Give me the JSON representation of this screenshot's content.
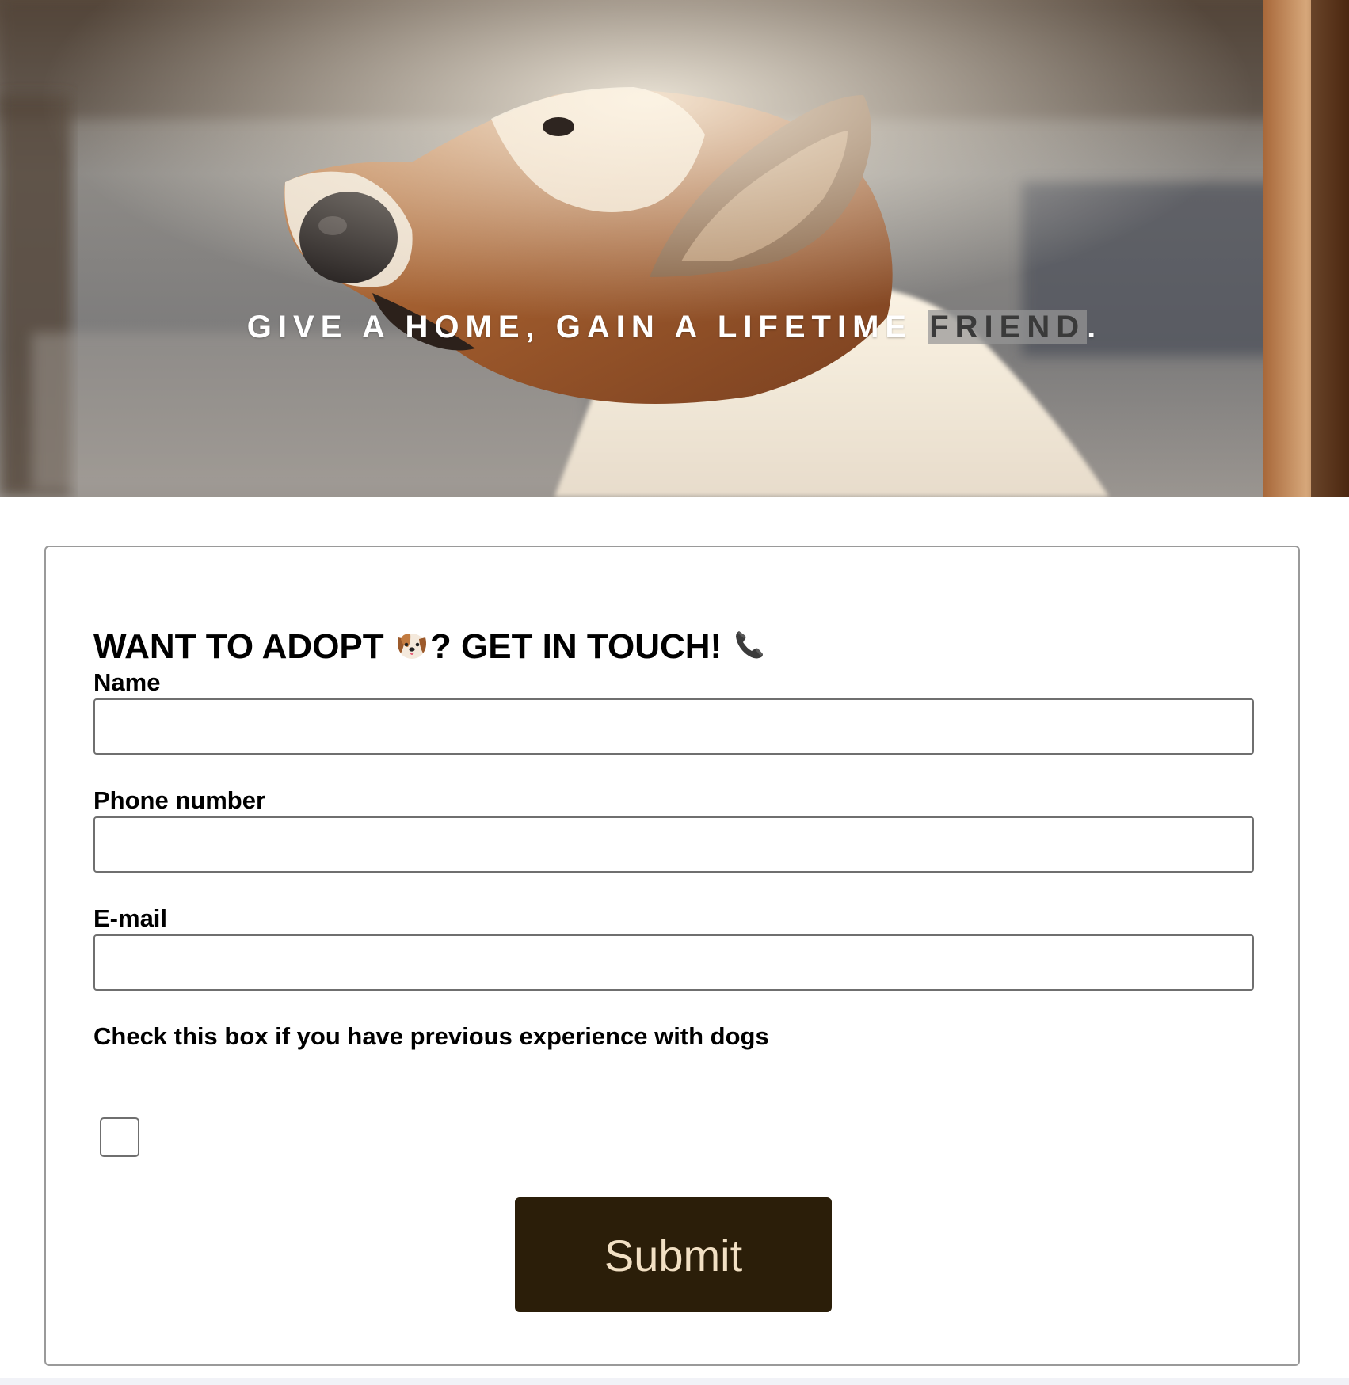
{
  "hero": {
    "tagline_main": "GIVE A HOME, GAIN A LIFETIME ",
    "tagline_highlight": "FRIEND",
    "tagline_end": ".",
    "image_icon": "dog-photo"
  },
  "form": {
    "title_part1": "WANT TO ADOPT ",
    "title_icon1": "dog-face-icon",
    "title_part2": "? GET IN TOUCH! ",
    "title_icon2": "telephone-icon",
    "fields": [
      {
        "label": "Name",
        "value": ""
      },
      {
        "label": "Phone number",
        "value": ""
      },
      {
        "label": "E-mail",
        "value": ""
      }
    ],
    "checkbox_label": "Check this box if you have previous experience with dogs",
    "checkbox_checked": false,
    "submit_label": "Submit"
  },
  "colors": {
    "submit_bg": "#2b1e09",
    "submit_text": "#f2e0c4",
    "highlight_bg": "#969696"
  }
}
